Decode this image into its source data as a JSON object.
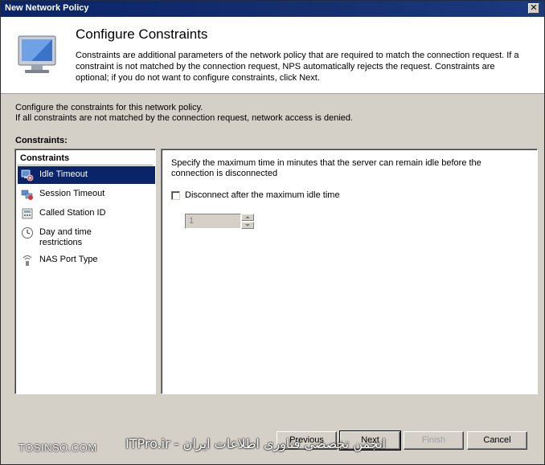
{
  "window": {
    "title": "New Network Policy",
    "close_glyph": "✕"
  },
  "header": {
    "icon": "monitor-icon",
    "heading": "Configure Constraints",
    "description": "Constraints are additional parameters of the network policy that are required to match the connection request. If a constraint is not matched by the connection request, NPS automatically rejects the request. Constraints are optional; if you do not want to configure constraints, click Next."
  },
  "intro": {
    "line1": "Configure the constraints for this network policy.",
    "line2": "If all constraints are not matched by the connection request, network access is denied."
  },
  "constraints_label": "Constraints:",
  "left_panel": {
    "group_header": "Constraints",
    "items": [
      {
        "label": "Idle Timeout",
        "icon": "idle-timeout-icon",
        "selected": true
      },
      {
        "label": "Session Timeout",
        "icon": "session-timeout-icon",
        "selected": false
      },
      {
        "label": "Called Station ID",
        "icon": "called-station-icon",
        "selected": false
      },
      {
        "label": "Day and time restrictions",
        "icon": "clock-icon",
        "selected": false
      },
      {
        "label": "NAS Port Type",
        "icon": "nas-port-icon",
        "selected": false
      }
    ]
  },
  "right_panel": {
    "spec": "Specify the maximum time in minutes that the server can remain idle before the connection is disconnected",
    "checkbox_label": "Disconnect after the maximum idle time",
    "checkbox_checked": false,
    "spinner_value": "1"
  },
  "buttons": {
    "previous": "Previous",
    "next": "Next",
    "finish": "Finish",
    "cancel": "Cancel"
  },
  "watermark": {
    "left": "TOSINSO.COM",
    "right": "انجمن تخصصی فناوری اطلاعات ایران - ITPro.ir"
  },
  "colors": {
    "titlebar": "#0a246a",
    "selection": "#0a246a",
    "dialog_bg": "#d4d0c8"
  }
}
